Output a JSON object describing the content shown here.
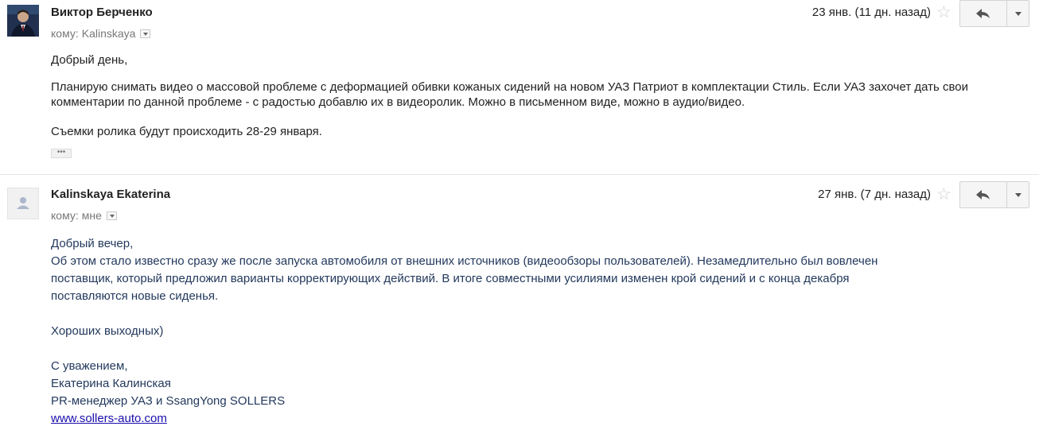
{
  "message1": {
    "sender": "Виктор Берченко",
    "to_prefix": "кому:",
    "to_recipient": "Kalinskaya",
    "date": "23 янв. (11 дн. назад)",
    "body": [
      "Добрый день,",
      "Планирую снимать видео о массовой проблеме с деформацией обивки кожаных сидений на новом УАЗ Патриот в комплектации Стиль. Если УАЗ захочет дать свои комментарии по данной проблеме - с радостью добавлю их в видеоролик. Можно в письменном виде, можно в аудио/видео.",
      "Съемки ролика будут происходить 28-29 января."
    ],
    "ellipsis": "•••"
  },
  "message2": {
    "sender": "Kalinskaya Ekaterina",
    "to_prefix": "кому:",
    "to_recipient": "мне",
    "date": "27 янв. (7 дн. назад)",
    "body_lines": [
      "Добрый вечер,",
      "Об этом стало известно сразу же после запуска автомобиля от внешних источников (видеообзоры пользователей). Незамедлительно был вовлечен",
      "поставщик, который предложил варианты корректирующих действий. В итоге совместными усилиями изменен крой сидений и с конца декабря",
      "поставляются новые сиденья.",
      "",
      "Хороших выходных)",
      "",
      "С уважением,",
      "Екатерина Калинская",
      "PR-менеджер УАЗ и SsangYong SOLLERS"
    ],
    "link": "www.sollers-auto.com"
  },
  "icons": {
    "star": "star-icon",
    "reply": "reply-icon",
    "more": "chevron-down-icon"
  },
  "colors": {
    "body2_text": "#23395d",
    "link": "#1a0dab",
    "button_bg": "#f5f5f5"
  }
}
